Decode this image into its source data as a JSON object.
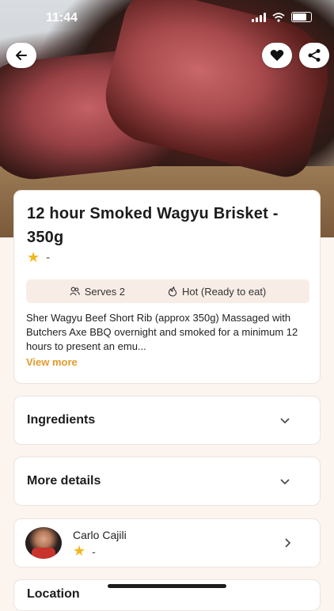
{
  "status_bar": {
    "time": "11:44"
  },
  "recipe": {
    "title": "12 hour Smoked Wagyu Brisket - 350g",
    "rating": "-",
    "serves": "Serves 2",
    "temperature": "Hot (Ready to eat)",
    "description": "Sher Wagyu Beef Short Rib (approx 350g) Massaged with Butchers Axe BBQ overnight and smoked for a minimum 12 hours to present an emu...",
    "view_more": "View more"
  },
  "sections": {
    "ingredients": "Ingredients",
    "more_details": "More details",
    "partial": "Location"
  },
  "chef": {
    "name": "Carlo Cajili",
    "rating": "-"
  },
  "icons": [
    "back-icon",
    "heart-icon",
    "share-icon",
    "star-icon",
    "people-icon",
    "flame-icon",
    "chevron-down-icon",
    "chevron-right-icon"
  ],
  "colors": {
    "accent": "#e59a2b",
    "star": "#f2b61d",
    "background": "#fbf4ef"
  }
}
